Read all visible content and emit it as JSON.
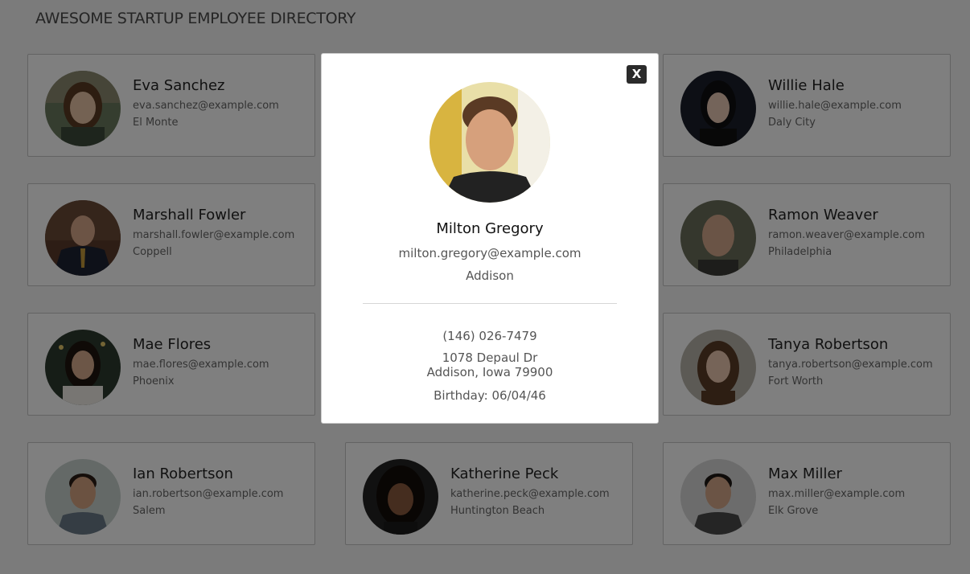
{
  "page_title": "AWESOME STARTUP EMPLOYEE DIRECTORY",
  "employees": [
    {
      "name": "Eva Sanchez",
      "email": "eva.sanchez@example.com",
      "city": "El Monte"
    },
    {
      "name": "Willie Hale",
      "email": "willie.hale@example.com",
      "city": "Daly City"
    },
    {
      "name": "Marshall Fowler",
      "email": "marshall.fowler@example.com",
      "city": "Coppell"
    },
    {
      "name": "Ramon Weaver",
      "email": "ramon.weaver@example.com",
      "city": "Philadelphia"
    },
    {
      "name": "Mae Flores",
      "email": "mae.flores@example.com",
      "city": "Phoenix"
    },
    {
      "name": "Tanya Robertson",
      "email": "tanya.robertson@example.com",
      "city": "Fort Worth"
    },
    {
      "name": "Ian Robertson",
      "email": "ian.robertson@example.com",
      "city": "Salem"
    },
    {
      "name": "Katherine Peck",
      "email": "katherine.peck@example.com",
      "city": "Huntington Beach"
    },
    {
      "name": "Max Miller",
      "email": "max.miller@example.com",
      "city": "Elk Grove"
    }
  ],
  "modal": {
    "close_label": "X",
    "name": "Milton Gregory",
    "email": "milton.gregory@example.com",
    "city": "Addison",
    "phone": "(146) 026-7479",
    "address_line1": "1078 Depaul Dr",
    "address_line2": "Addison, Iowa 79900",
    "birthday": "Birthday: 06/04/46"
  },
  "colors": {
    "overlay": "#000000",
    "close_button": "#2b2b2b",
    "card_border": "#cccccc"
  },
  "icons": {
    "close": "close-icon"
  }
}
